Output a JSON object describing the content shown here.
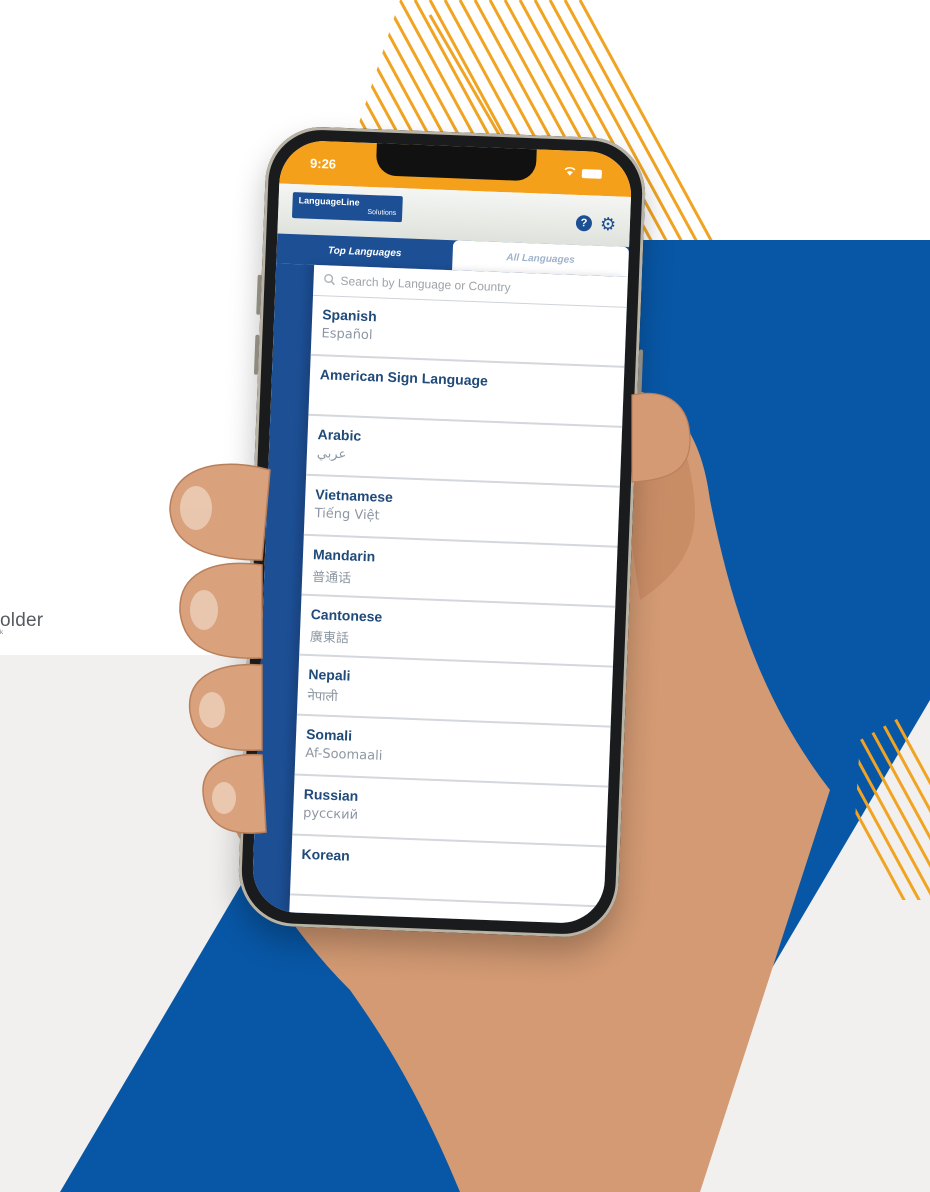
{
  "edge_text": {
    "main": "older",
    "sub": "k"
  },
  "status_bar": {
    "time": "9:26"
  },
  "app": {
    "logo_line1": "LanguageLine",
    "logo_line2": "Solutions"
  },
  "icons": {
    "help": "question-circle-icon",
    "settings": "gear-icon",
    "search": "magnifier-icon",
    "wifi": "wifi-icon",
    "battery": "battery-icon"
  },
  "tabs": [
    {
      "label": "Top Languages",
      "active": true
    },
    {
      "label": "All Languages",
      "active": false
    }
  ],
  "search": {
    "placeholder": "Search by Language or Country"
  },
  "languages": [
    {
      "name": "Spanish",
      "native": "Español"
    },
    {
      "name": "American Sign Language",
      "native": ""
    },
    {
      "name": "Arabic",
      "native": "عربي"
    },
    {
      "name": "Vietnamese",
      "native": "Tiếng Việt"
    },
    {
      "name": "Mandarin",
      "native": "普通话"
    },
    {
      "name": "Cantonese",
      "native": "廣東話"
    },
    {
      "name": "Nepali",
      "native": "नेपाली"
    },
    {
      "name": "Somali",
      "native": "Af-Soomaali"
    },
    {
      "name": "Russian",
      "native": "русский"
    },
    {
      "name": "Korean",
      "native": ""
    }
  ],
  "colors": {
    "orange": "#f4a01a",
    "blue": "#1d4f95",
    "skin": "#d9a27c",
    "light_gray": "#f1f0ee"
  }
}
